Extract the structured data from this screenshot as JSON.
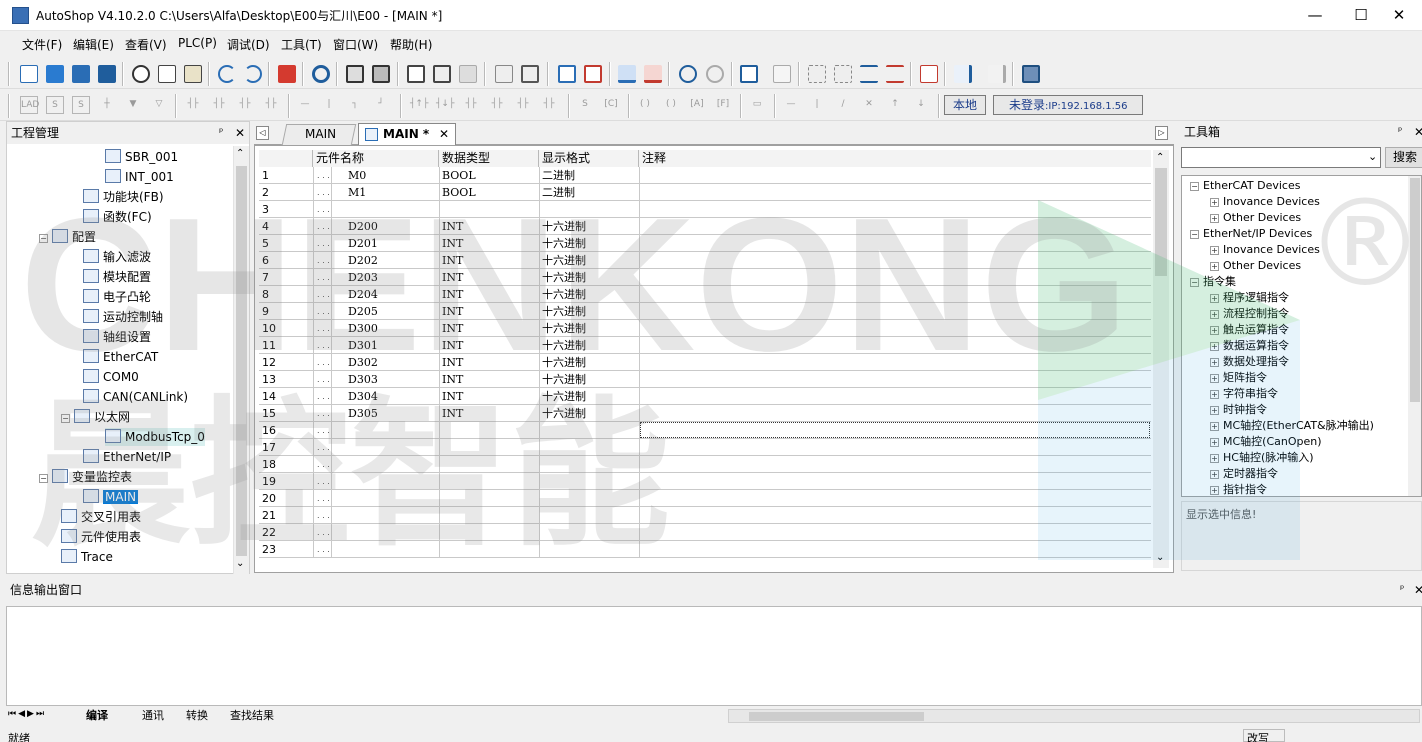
{
  "window": {
    "title": "AutoShop V4.10.2.0  C:\\Users\\Alfa\\Desktop\\E00与汇川\\E00 - [MAIN *]",
    "minimize": "—",
    "maximize": "☐",
    "close": "✕"
  },
  "menu": [
    "文件(F)",
    "编辑(E)",
    "查看(V)",
    "PLC(P)",
    "调试(D)",
    "工具(T)",
    "窗口(W)",
    "帮助(H)"
  ],
  "toolbar2": {
    "local_label": "本地",
    "login_label": "未登录",
    "ip_label": ":IP:192.168.1.56"
  },
  "project": {
    "title": "工程管理",
    "pin": "ᵖ",
    "close": "✕",
    "items": [
      "SBR_001",
      "INT_001",
      "功能块(FB)",
      "函数(FC)",
      "配置",
      "输入滤波",
      "模块配置",
      "电子凸轮",
      "运动控制轴",
      "轴组设置",
      "EtherCAT",
      "COM0",
      "CAN(CANLink)",
      "以太网",
      "ModbusTcp_0",
      "EtherNet/IP",
      "变量监控表",
      "MAIN",
      "交叉引用表",
      "元件使用表",
      "Trace"
    ]
  },
  "tabs": {
    "scroll_left": "◁",
    "scroll_right": "▷",
    "tab1": "MAIN",
    "tab2": "MAIN *",
    "tab_close": "✕"
  },
  "grid": {
    "headers": [
      "元件名称",
      "数据类型",
      "显示格式",
      "注释"
    ],
    "rows": [
      {
        "n": "1",
        "dots": ". . .",
        "name": "M0",
        "type": "BOOL",
        "fmt": "二进制"
      },
      {
        "n": "2",
        "dots": ". . .",
        "name": "M1",
        "type": "BOOL",
        "fmt": "二进制"
      },
      {
        "n": "3",
        "dots": ". . .",
        "name": "",
        "type": "",
        "fmt": ""
      },
      {
        "n": "4",
        "dots": ". . .",
        "name": "D200",
        "type": "INT",
        "fmt": "十六进制"
      },
      {
        "n": "5",
        "dots": ". . .",
        "name": "D201",
        "type": "INT",
        "fmt": "十六进制"
      },
      {
        "n": "6",
        "dots": ". . .",
        "name": "D202",
        "type": "INT",
        "fmt": "十六进制"
      },
      {
        "n": "7",
        "dots": ". . .",
        "name": "D203",
        "type": "INT",
        "fmt": "十六进制"
      },
      {
        "n": "8",
        "dots": ". . .",
        "name": "D204",
        "type": "INT",
        "fmt": "十六进制"
      },
      {
        "n": "9",
        "dots": ". . .",
        "name": "D205",
        "type": "INT",
        "fmt": "十六进制"
      },
      {
        "n": "10",
        "dots": ". . .",
        "name": "D300",
        "type": "INT",
        "fmt": "十六进制"
      },
      {
        "n": "11",
        "dots": ". . .",
        "name": "D301",
        "type": "INT",
        "fmt": "十六进制"
      },
      {
        "n": "12",
        "dots": ". . .",
        "name": "D302",
        "type": "INT",
        "fmt": "十六进制"
      },
      {
        "n": "13",
        "dots": ". . .",
        "name": "D303",
        "type": "INT",
        "fmt": "十六进制"
      },
      {
        "n": "14",
        "dots": ". . .",
        "name": "D304",
        "type": "INT",
        "fmt": "十六进制"
      },
      {
        "n": "15",
        "dots": ". . .",
        "name": "D305",
        "type": "INT",
        "fmt": "十六进制"
      },
      {
        "n": "16",
        "dots": ". . .",
        "name": "",
        "type": "",
        "fmt": ""
      },
      {
        "n": "17",
        "dots": ". . .",
        "name": "",
        "type": "",
        "fmt": ""
      },
      {
        "n": "18",
        "dots": ". . .",
        "name": "",
        "type": "",
        "fmt": ""
      },
      {
        "n": "19",
        "dots": ". . .",
        "name": "",
        "type": "",
        "fmt": ""
      },
      {
        "n": "20",
        "dots": ". . .",
        "name": "",
        "type": "",
        "fmt": ""
      },
      {
        "n": "21",
        "dots": ". . .",
        "name": "",
        "type": "",
        "fmt": ""
      },
      {
        "n": "22",
        "dots": ". . .",
        "name": "",
        "type": "",
        "fmt": ""
      },
      {
        "n": "23",
        "dots": ". . .",
        "name": "",
        "type": "",
        "fmt": ""
      }
    ]
  },
  "toolbox": {
    "title": "工具箱",
    "search_button": "搜索",
    "dropdown_arrow": "⌄",
    "tree": [
      {
        "label": "EtherCAT Devices",
        "level": 0,
        "sign": "−"
      },
      {
        "label": "Inovance Devices",
        "level": 1,
        "sign": "+"
      },
      {
        "label": "Other Devices",
        "level": 1,
        "sign": "+"
      },
      {
        "label": "EtherNet/IP Devices",
        "level": 0,
        "sign": "−"
      },
      {
        "label": "Inovance Devices",
        "level": 1,
        "sign": "+"
      },
      {
        "label": "Other Devices",
        "level": 1,
        "sign": "+"
      },
      {
        "label": "指令集",
        "level": 0,
        "sign": "−"
      },
      {
        "label": "程序逻辑指令",
        "level": 1,
        "sign": "+"
      },
      {
        "label": "流程控制指令",
        "level": 1,
        "sign": "+"
      },
      {
        "label": "触点运算指令",
        "level": 1,
        "sign": "+"
      },
      {
        "label": "数据运算指令",
        "level": 1,
        "sign": "+"
      },
      {
        "label": "数据处理指令",
        "level": 1,
        "sign": "+"
      },
      {
        "label": "矩阵指令",
        "level": 1,
        "sign": "+"
      },
      {
        "label": "字符串指令",
        "level": 1,
        "sign": "+"
      },
      {
        "label": "时钟指令",
        "level": 1,
        "sign": "+"
      },
      {
        "label": "MC轴控(EtherCAT&脉冲输出)",
        "level": 1,
        "sign": "+"
      },
      {
        "label": "MC轴控(CanOpen)",
        "level": 1,
        "sign": "+"
      },
      {
        "label": "HC轴控(脉冲输入)",
        "level": 1,
        "sign": "+"
      },
      {
        "label": "定时器指令",
        "level": 1,
        "sign": "+"
      },
      {
        "label": "指针指令",
        "level": 1,
        "sign": "+"
      }
    ],
    "info": "显示选中信息!"
  },
  "output": {
    "title": "信息输出窗口",
    "tabs": [
      "编译",
      "通讯",
      "转换",
      "查找结果"
    ]
  },
  "status": {
    "left": "就绪",
    "right": "改写"
  },
  "watermark": {
    "latin": "CHENKONG",
    "cn": "晨控智能",
    "reg": "®"
  },
  "colors": {
    "selection": "#0078d7",
    "accent": "#3a6fb5"
  }
}
